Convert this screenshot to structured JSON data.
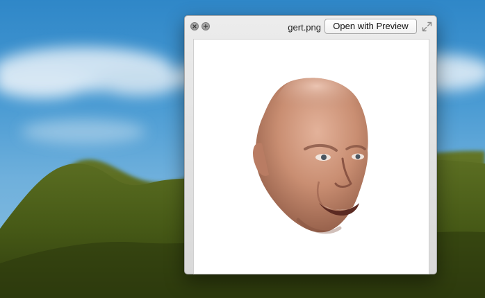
{
  "window": {
    "file_name": "gert.png",
    "open_button_label": "Open with Preview"
  },
  "icons": {
    "close": "close-icon",
    "zoom": "zoom-icon",
    "fullscreen": "fullscreen-icon"
  },
  "colors": {
    "sky": "#4a9bd3",
    "hill": "#4c5f1a",
    "window_chrome": "#e3e3e3",
    "image_background": "#ffffff"
  }
}
